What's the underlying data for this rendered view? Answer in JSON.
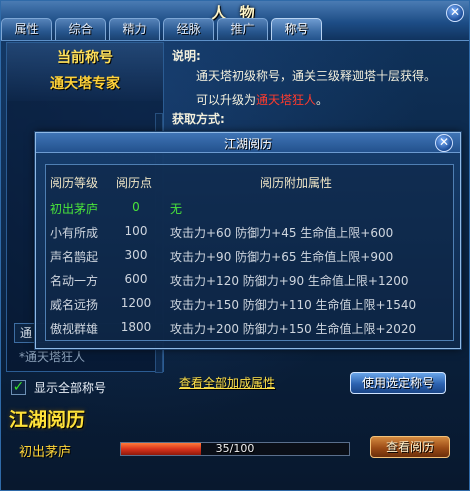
{
  "window": {
    "title": "人 物",
    "tabs": [
      {
        "label": "属性",
        "active": false
      },
      {
        "label": "综合",
        "active": false
      },
      {
        "label": "精力",
        "active": false
      },
      {
        "label": "经脉",
        "active": false
      },
      {
        "label": "推广",
        "active": false
      },
      {
        "label": "称号",
        "active": true
      }
    ]
  },
  "title_panel": {
    "current_label": "当前称号",
    "current_value": "通天塔专家",
    "dropdown_value": "通",
    "dropdown_value2": "*通天塔狂人",
    "show_all_label": "显示全部称号",
    "show_all_checked": true
  },
  "description": {
    "label": "说明:",
    "line1": "通天塔初级称号，通关三级释迦塔十层获得。",
    "line2_prefix": "可以升级为",
    "line2_highlight": "通天塔狂人",
    "line2_suffix": "。",
    "obtain_label": "获取方式:"
  },
  "actions": {
    "view_all_bonus": "查看全部加成属性",
    "use_selected": "使用选定称号"
  },
  "experience": {
    "heading": "江湖阅历",
    "current_rank": "初出茅庐",
    "progress_text": "35/100",
    "progress_fraction": 0.35,
    "view_button": "查看阅历"
  },
  "popup": {
    "title": "江湖阅历",
    "headers": {
      "level": "阅历等级",
      "points": "阅历点",
      "bonus": "阅历附加属性"
    },
    "rows": [
      {
        "level": "初出茅庐",
        "points": "0",
        "bonus": "无",
        "current": true
      },
      {
        "level": "小有所成",
        "points": "100",
        "bonus": "攻击力+60 防御力+45 生命值上限+600",
        "current": false
      },
      {
        "level": "声名鹊起",
        "points": "300",
        "bonus": "攻击力+90 防御力+65 生命值上限+900",
        "current": false
      },
      {
        "level": "名动一方",
        "points": "600",
        "bonus": "攻击力+120 防御力+90 生命值上限+1200",
        "current": false
      },
      {
        "level": "威名远扬",
        "points": "1200",
        "bonus": "攻击力+150 防御力+110 生命值上限+1540",
        "current": false
      },
      {
        "level": "傲视群雄",
        "points": "1800",
        "bonus": "攻击力+200 防御力+150 生命值上限+2020",
        "current": false
      }
    ]
  },
  "colors": {
    "accent_gold": "#ffe23a",
    "highlight_red": "#ff3b2d",
    "current_green": "#4ae53a",
    "progress_red": "#d9331c"
  },
  "icons": [
    "close-icon",
    "checkmark-icon"
  ]
}
